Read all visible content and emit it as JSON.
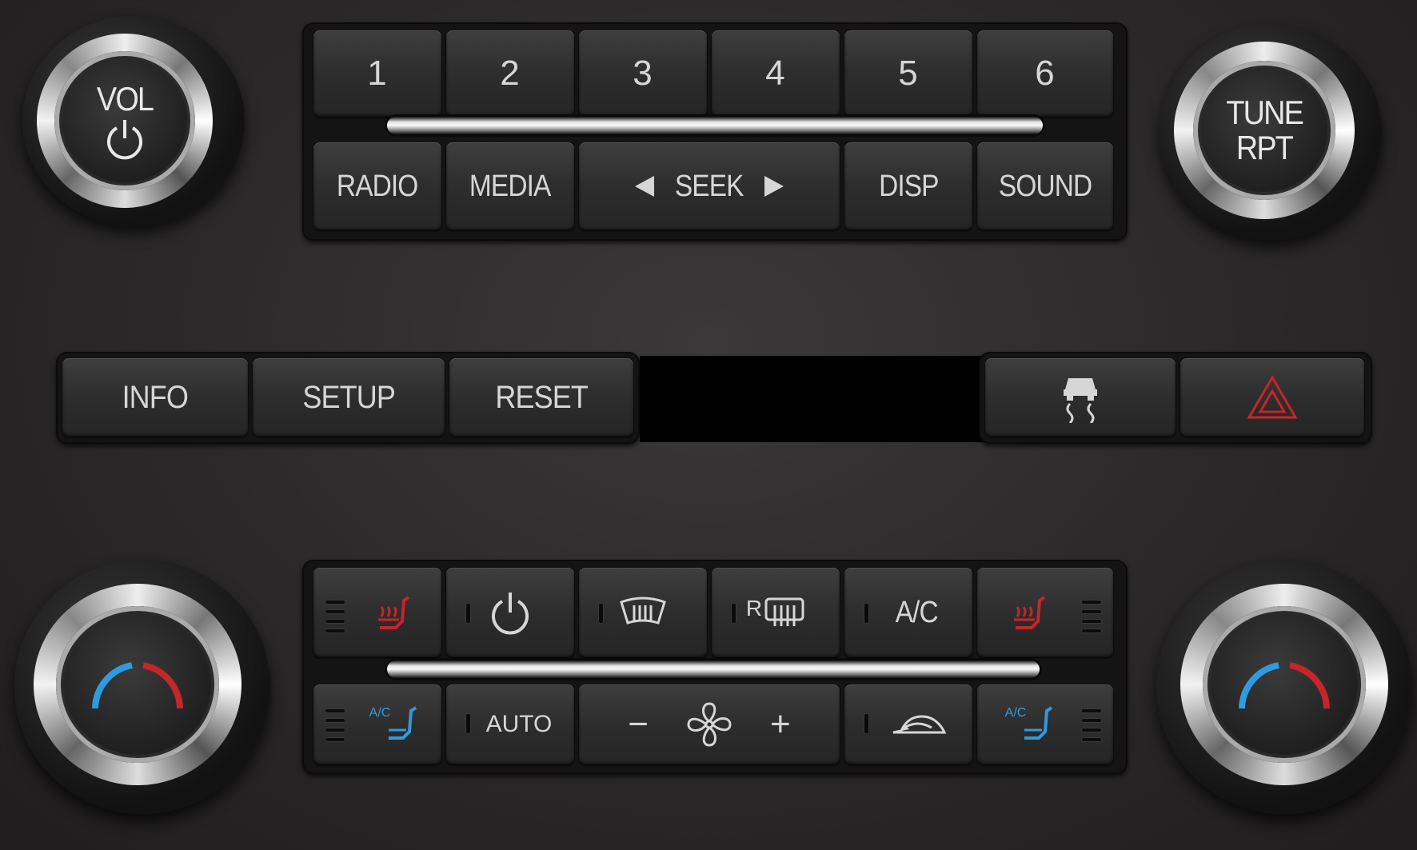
{
  "colors": {
    "background": "#2a2828",
    "button_text": "#d6d6d6",
    "heat_red": "#c4262c",
    "cool_blue": "#2e9be0",
    "hazard_red": "#c4262c"
  },
  "radio": {
    "volume_knob": {
      "label": "VOL",
      "icon": "power-icon"
    },
    "tune_knob": {
      "line1": "TUNE",
      "line2": "RPT"
    },
    "presets": [
      "1",
      "2",
      "3",
      "4",
      "5",
      "6"
    ],
    "buttons": {
      "radio": "RADIO",
      "media": "MEDIA",
      "seek": "SEEK",
      "disp": "DISP",
      "sound": "SOUND"
    }
  },
  "middle_row": {
    "info": "INFO",
    "setup": "SETUP",
    "reset": "RESET",
    "traction_icon": "traction-control-icon",
    "hazard_icon": "hazard-icon"
  },
  "climate": {
    "top_row_icons": [
      "heated-seat-left-icon",
      "power-icon",
      "front-defrost-icon",
      "rear-defrost-icon",
      "ac-label",
      "heated-seat-right-icon"
    ],
    "ac_label": "A/C",
    "rear_defrost_letter": "R",
    "auto_label": "AUTO",
    "fan_minus": "−",
    "fan_plus": "+",
    "cooled_seat_label": "A/C",
    "bottom_row_icons": [
      "cooled-seat-left-icon",
      "auto-button",
      "fan-speed-control",
      "recirculation-icon",
      "cooled-seat-right-icon"
    ]
  }
}
